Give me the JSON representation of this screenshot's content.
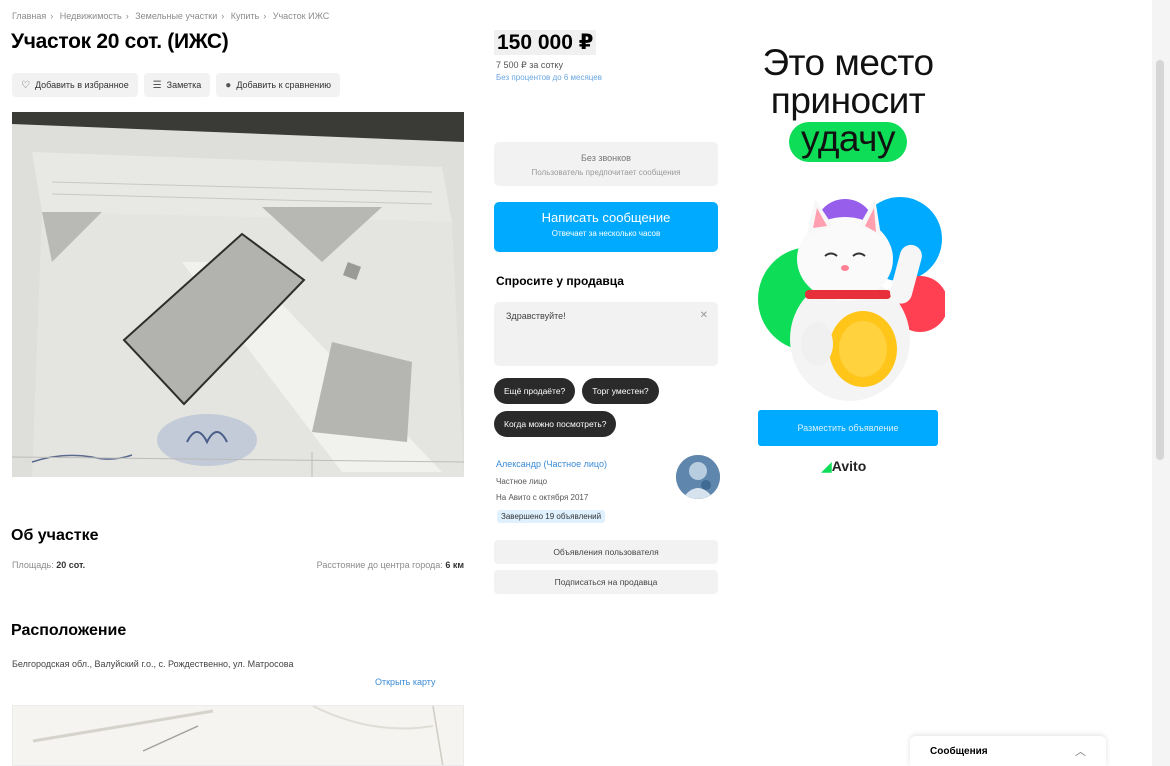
{
  "breadcrumb": [
    "Главная",
    "Недвижимость",
    "Земельные участки",
    "Купить",
    "Участок ИЖС"
  ],
  "listing": {
    "title": "Участок 20 сот. (ИЖС)",
    "actions": [
      {
        "icon": "heart-icon",
        "glyph": "♡",
        "label": "Добавить в избранное"
      },
      {
        "icon": "note-icon",
        "glyph": "☰",
        "label": "Заметка"
      },
      {
        "icon": "compare-icon",
        "glyph": "●",
        "label": "Добавить к сравнению"
      }
    ]
  },
  "about": {
    "heading": "Об участке",
    "area_label": "Площадь:",
    "area_value": "20 сот.",
    "distance_label": "Расстояние до центра города:",
    "distance_value": "6 км"
  },
  "location": {
    "heading": "Расположение",
    "address": "Белгородская обл., Валуйский г.о., с. Рождественно, ул. Матросова",
    "map_link": "Открыть карту"
  },
  "price": {
    "value": "150 000 ₽",
    "per_unit": "7 500 ₽ за сотку",
    "link": "Без процентов до 6 месяцев"
  },
  "contact": {
    "no_calls": "Без звонков",
    "no_calls_sub": "Пользователь предпочитает сообщения",
    "write_button": "Написать сообщение",
    "write_sub": "Отвечает за несколько часов"
  },
  "ask": {
    "heading": "Спросите у продавца",
    "input_value": "Здравствуйте!",
    "chips": [
      "Ещё продаёте?",
      "Торг уместен?",
      "Когда можно посмотреть?"
    ]
  },
  "seller": {
    "name": "Александр (Частное лицо)",
    "type": "Частное лицо",
    "since": "На Авито с октября 2017",
    "badge": "Завершено 19 объявлений",
    "subscribe_button": "Подписаться на продавца",
    "other_ads_button": "Объявления пользователя"
  },
  "ad": {
    "line1": "Это место",
    "line2": "приносит",
    "line3": "удачу",
    "cta": "Разместить объявление",
    "logo": "Avito",
    "colors": {
      "green": "#0edd57",
      "blue": "#00aaff",
      "red": "#ff4053",
      "purple": "#965eeb"
    }
  },
  "messages_bar": {
    "label": "Сообщения",
    "chevron": "︿"
  }
}
